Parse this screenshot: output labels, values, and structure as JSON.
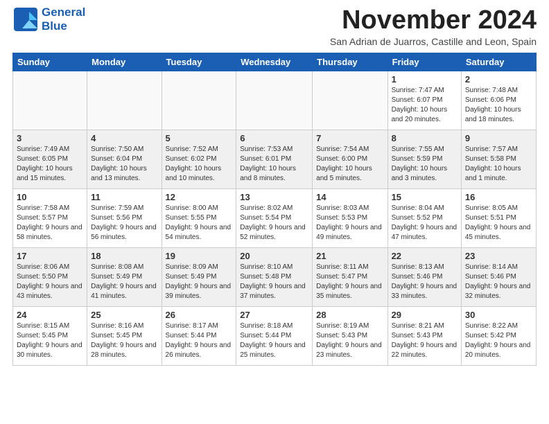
{
  "header": {
    "month_year": "November 2024",
    "location": "San Adrian de Juarros, Castille and Leon, Spain",
    "logo_line1": "General",
    "logo_line2": "Blue"
  },
  "columns": [
    "Sunday",
    "Monday",
    "Tuesday",
    "Wednesday",
    "Thursday",
    "Friday",
    "Saturday"
  ],
  "weeks": [
    [
      {
        "day": "",
        "info": ""
      },
      {
        "day": "",
        "info": ""
      },
      {
        "day": "",
        "info": ""
      },
      {
        "day": "",
        "info": ""
      },
      {
        "day": "",
        "info": ""
      },
      {
        "day": "1",
        "info": "Sunrise: 7:47 AM\nSunset: 6:07 PM\nDaylight: 10 hours and 20 minutes."
      },
      {
        "day": "2",
        "info": "Sunrise: 7:48 AM\nSunset: 6:06 PM\nDaylight: 10 hours and 18 minutes."
      }
    ],
    [
      {
        "day": "3",
        "info": "Sunrise: 7:49 AM\nSunset: 6:05 PM\nDaylight: 10 hours and 15 minutes."
      },
      {
        "day": "4",
        "info": "Sunrise: 7:50 AM\nSunset: 6:04 PM\nDaylight: 10 hours and 13 minutes."
      },
      {
        "day": "5",
        "info": "Sunrise: 7:52 AM\nSunset: 6:02 PM\nDaylight: 10 hours and 10 minutes."
      },
      {
        "day": "6",
        "info": "Sunrise: 7:53 AM\nSunset: 6:01 PM\nDaylight: 10 hours and 8 minutes."
      },
      {
        "day": "7",
        "info": "Sunrise: 7:54 AM\nSunset: 6:00 PM\nDaylight: 10 hours and 5 minutes."
      },
      {
        "day": "8",
        "info": "Sunrise: 7:55 AM\nSunset: 5:59 PM\nDaylight: 10 hours and 3 minutes."
      },
      {
        "day": "9",
        "info": "Sunrise: 7:57 AM\nSunset: 5:58 PM\nDaylight: 10 hours and 1 minute."
      }
    ],
    [
      {
        "day": "10",
        "info": "Sunrise: 7:58 AM\nSunset: 5:57 PM\nDaylight: 9 hours and 58 minutes."
      },
      {
        "day": "11",
        "info": "Sunrise: 7:59 AM\nSunset: 5:56 PM\nDaylight: 9 hours and 56 minutes."
      },
      {
        "day": "12",
        "info": "Sunrise: 8:00 AM\nSunset: 5:55 PM\nDaylight: 9 hours and 54 minutes."
      },
      {
        "day": "13",
        "info": "Sunrise: 8:02 AM\nSunset: 5:54 PM\nDaylight: 9 hours and 52 minutes."
      },
      {
        "day": "14",
        "info": "Sunrise: 8:03 AM\nSunset: 5:53 PM\nDaylight: 9 hours and 49 minutes."
      },
      {
        "day": "15",
        "info": "Sunrise: 8:04 AM\nSunset: 5:52 PM\nDaylight: 9 hours and 47 minutes."
      },
      {
        "day": "16",
        "info": "Sunrise: 8:05 AM\nSunset: 5:51 PM\nDaylight: 9 hours and 45 minutes."
      }
    ],
    [
      {
        "day": "17",
        "info": "Sunrise: 8:06 AM\nSunset: 5:50 PM\nDaylight: 9 hours and 43 minutes."
      },
      {
        "day": "18",
        "info": "Sunrise: 8:08 AM\nSunset: 5:49 PM\nDaylight: 9 hours and 41 minutes."
      },
      {
        "day": "19",
        "info": "Sunrise: 8:09 AM\nSunset: 5:49 PM\nDaylight: 9 hours and 39 minutes."
      },
      {
        "day": "20",
        "info": "Sunrise: 8:10 AM\nSunset: 5:48 PM\nDaylight: 9 hours and 37 minutes."
      },
      {
        "day": "21",
        "info": "Sunrise: 8:11 AM\nSunset: 5:47 PM\nDaylight: 9 hours and 35 minutes."
      },
      {
        "day": "22",
        "info": "Sunrise: 8:13 AM\nSunset: 5:46 PM\nDaylight: 9 hours and 33 minutes."
      },
      {
        "day": "23",
        "info": "Sunrise: 8:14 AM\nSunset: 5:46 PM\nDaylight: 9 hours and 32 minutes."
      }
    ],
    [
      {
        "day": "24",
        "info": "Sunrise: 8:15 AM\nSunset: 5:45 PM\nDaylight: 9 hours and 30 minutes."
      },
      {
        "day": "25",
        "info": "Sunrise: 8:16 AM\nSunset: 5:45 PM\nDaylight: 9 hours and 28 minutes."
      },
      {
        "day": "26",
        "info": "Sunrise: 8:17 AM\nSunset: 5:44 PM\nDaylight: 9 hours and 26 minutes."
      },
      {
        "day": "27",
        "info": "Sunrise: 8:18 AM\nSunset: 5:44 PM\nDaylight: 9 hours and 25 minutes."
      },
      {
        "day": "28",
        "info": "Sunrise: 8:19 AM\nSunset: 5:43 PM\nDaylight: 9 hours and 23 minutes."
      },
      {
        "day": "29",
        "info": "Sunrise: 8:21 AM\nSunset: 5:43 PM\nDaylight: 9 hours and 22 minutes."
      },
      {
        "day": "30",
        "info": "Sunrise: 8:22 AM\nSunset: 5:42 PM\nDaylight: 9 hours and 20 minutes."
      }
    ]
  ]
}
